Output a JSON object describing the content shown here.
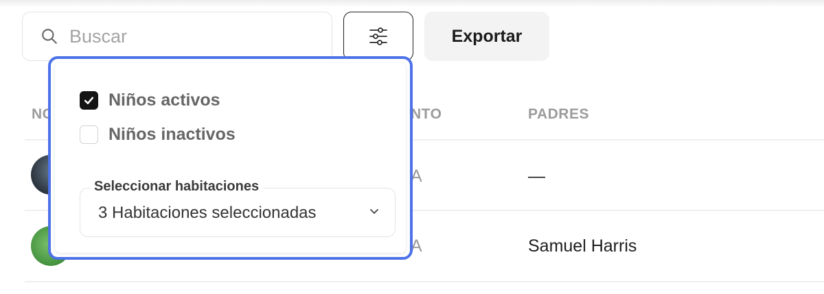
{
  "toolbar": {
    "search_placeholder": "Buscar",
    "search_icon": "search-icon",
    "filter_icon": "sliders-icon",
    "export_label": "Exportar"
  },
  "table": {
    "columns": [
      {
        "label": "NO"
      },
      {
        "label": "NTO"
      },
      {
        "label": "PADRES"
      }
    ],
    "rows": [
      {
        "parents": "—",
        "status_fragment": "A"
      },
      {
        "parents": "Samuel Harris",
        "status_fragment": "A"
      }
    ]
  },
  "filter_popover": {
    "options": [
      {
        "label": "Niños activos",
        "checked": true
      },
      {
        "label": "Niños inactivos",
        "checked": false
      }
    ],
    "room_select": {
      "legend": "Seleccionar habitaciones",
      "value": "3 Habitaciones seleccionadas",
      "icon": "chevron-down-icon"
    }
  },
  "colors": {
    "focus_outline": "#4d72e8",
    "checkbox_checked": "#141414",
    "header_text": "#9b9b9b"
  }
}
